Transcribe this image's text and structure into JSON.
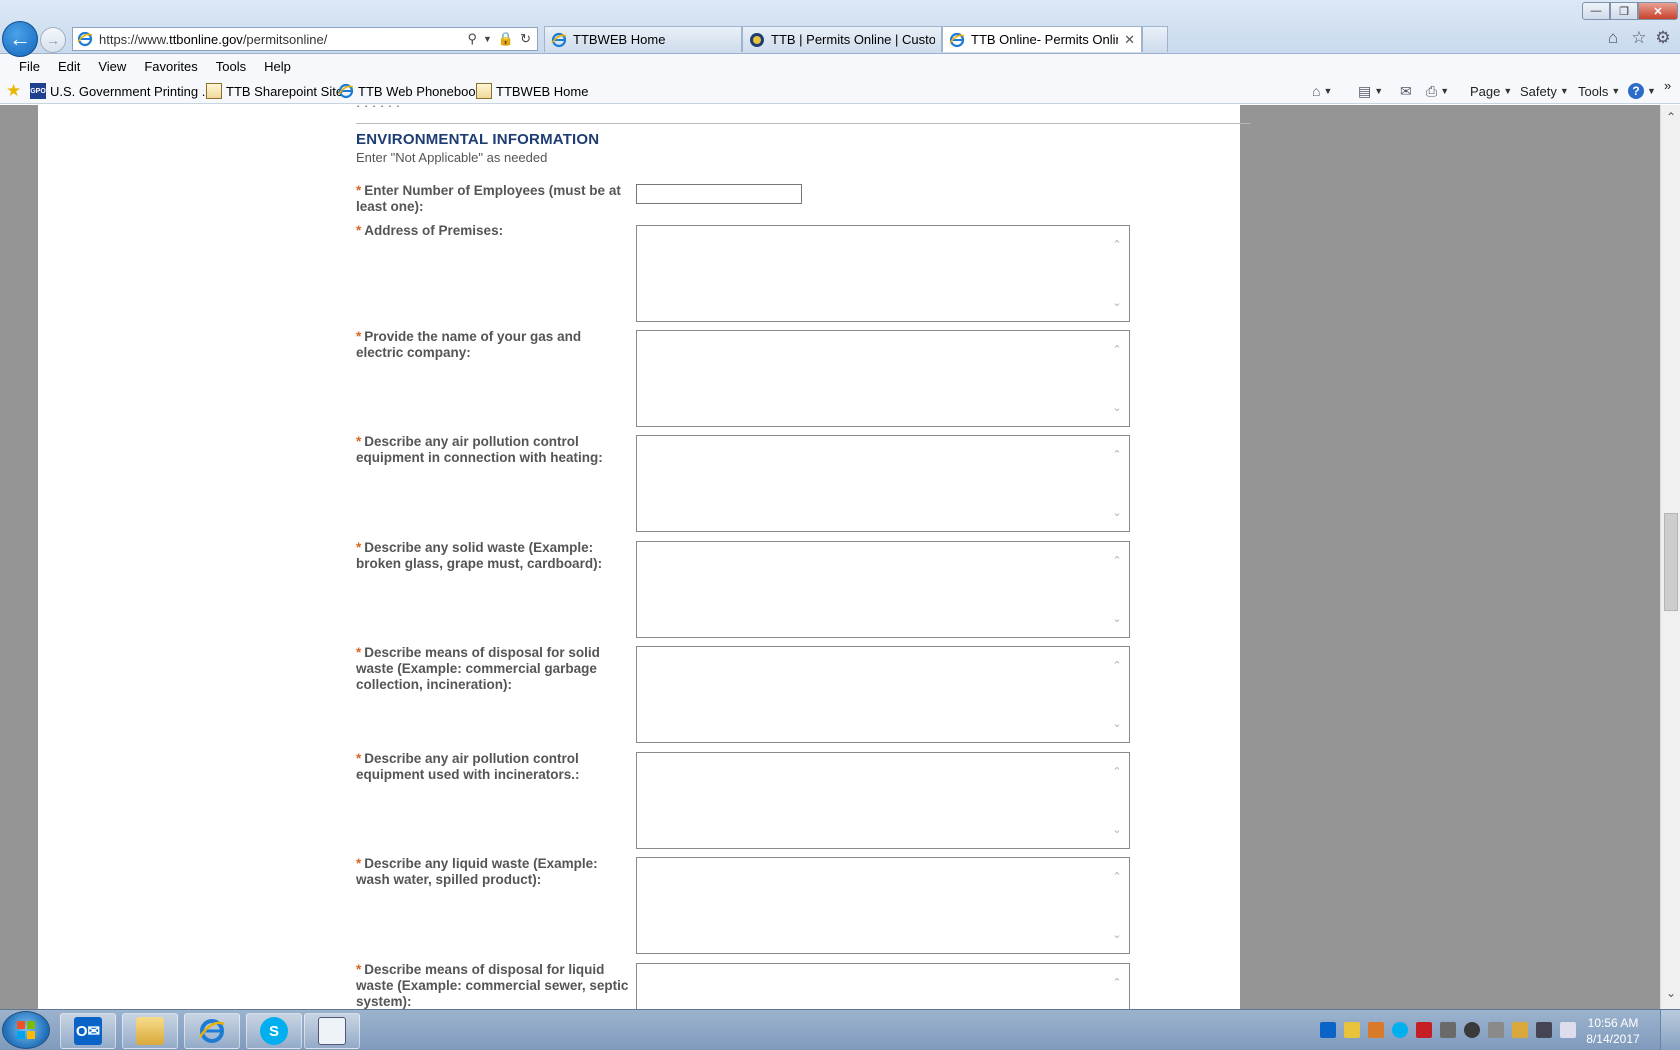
{
  "browser": {
    "url_prefix": "https://www.",
    "url_domain": "ttbonline.gov",
    "url_path": "/permitsonline/",
    "tabs": [
      {
        "label": "TTBWEB Home",
        "close": ""
      },
      {
        "label": "TTB | Permits Online | Custom...",
        "close": ""
      },
      {
        "label": "TTB Online- Permits Online...",
        "close": "✕"
      }
    ],
    "window_controls": {
      "minimize": "—",
      "maximize": "❐",
      "close": "✕"
    }
  },
  "menu": [
    "File",
    "Edit",
    "View",
    "Favorites",
    "Tools",
    "Help"
  ],
  "favorites": [
    {
      "label": "U.S. Government Printing ...",
      "icon": "GPO"
    },
    {
      "label": "TTB Sharepoint Site"
    },
    {
      "label": "TTB Web Phonebook"
    },
    {
      "label": "TTBWEB Home"
    }
  ],
  "command_bar": {
    "page": "Page",
    "safety": "Safety",
    "tools": "Tools",
    "help": "?",
    "overflow": "»"
  },
  "form": {
    "clipped_text": "· · · · · ·",
    "section_title": "ENVIRONMENTAL INFORMATION",
    "section_hint": "Enter \"Not Applicable\" as needed",
    "required_marker": "*",
    "fields": [
      {
        "label": "Enter Number of Employees (must be at least one):",
        "type": "text",
        "value": ""
      },
      {
        "label": "Address of Premises:",
        "type": "textarea",
        "value": ""
      },
      {
        "label": "Provide the name of your gas and electric company:",
        "type": "textarea",
        "value": ""
      },
      {
        "label": "Describe any air pollution control equipment in connection with heating:",
        "type": "textarea",
        "value": ""
      },
      {
        "label": "Describe any solid waste (Example: broken glass, grape must, cardboard):",
        "type": "textarea",
        "value": ""
      },
      {
        "label": "Describe means of disposal for solid waste (Example: commercial garbage collection, incineration):",
        "type": "textarea",
        "value": ""
      },
      {
        "label": "Describe any air pollution control equipment used with incinerators.:",
        "type": "textarea",
        "value": ""
      },
      {
        "label": "Describe any liquid waste (Example: wash water, spilled product):",
        "type": "textarea",
        "value": ""
      },
      {
        "label": "Describe means of disposal for liquid waste (Example: commercial sewer, septic system):",
        "type": "textarea",
        "value": ""
      }
    ]
  },
  "taskbar": {
    "apps": [
      "outlook",
      "file-explorer",
      "internet-explorer",
      "skype",
      "notepad"
    ],
    "clock_time": "10:56 AM",
    "clock_date": "8/14/2017"
  },
  "colors": {
    "accent_title": "#1d3d73",
    "required": "#d9661e",
    "label": "#555555"
  }
}
